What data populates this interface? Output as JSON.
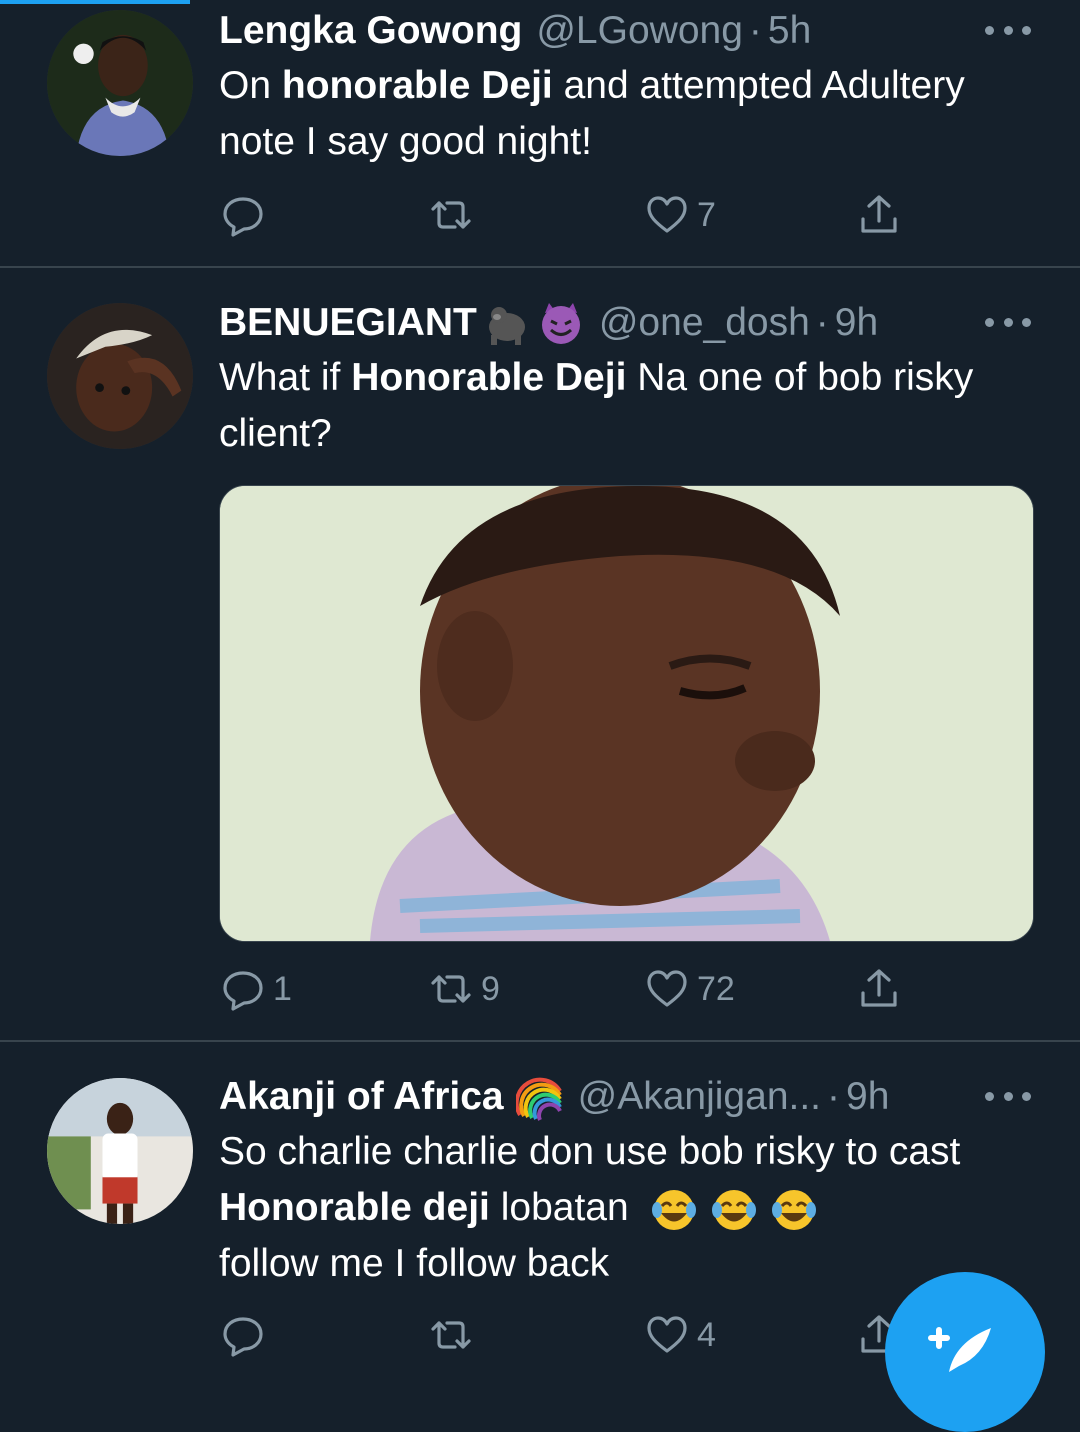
{
  "colors": {
    "background": "#15202b",
    "accent": "#1da1f2",
    "secondary_text": "#8899a6",
    "divider": "#38444d"
  },
  "tweets": [
    {
      "name": "Lengka Gowong",
      "handle": "@LGowong",
      "time": "5h",
      "text_parts": [
        "On ",
        "honorable Deji",
        " and attempted Adultery note I say good night!"
      ],
      "replies": "",
      "retweets": "",
      "likes": "7",
      "avatar_icon": "avatar-man-green-background"
    },
    {
      "name": "BENUEGIANT",
      "emoji_icons": [
        "gorilla-emoji",
        "smiling-imp-emoji"
      ],
      "handle": "@one_dosh",
      "time": "9h",
      "text_parts": [
        "What if ",
        "Honorable Deji",
        " Na one of bob risky client?"
      ],
      "replies": "1",
      "retweets": "9",
      "likes": "72",
      "media_icon": "side-eye-child-meme-image",
      "avatar_icon": "avatar-man-bleached-hair"
    },
    {
      "name": "Akanji of Africa",
      "emoji_icons": [
        "rainbow-emoji"
      ],
      "handle": "@Akanjigan...",
      "time": "9h",
      "text_parts": [
        "So charlie charlie don use bob risky to cast ",
        "Honorable deji",
        " lobatan",
        " follow me I follow back"
      ],
      "text_emoji_icons": [
        "face-with-tears-of-joy-emoji",
        "face-with-tears-of-joy-emoji",
        "face-with-tears-of-joy-emoji"
      ],
      "replies": "",
      "retweets": "",
      "likes": "4",
      "avatar_icon": "avatar-man-outdoors"
    }
  ],
  "compose_button": {
    "icon": "compose-tweet-icon"
  }
}
